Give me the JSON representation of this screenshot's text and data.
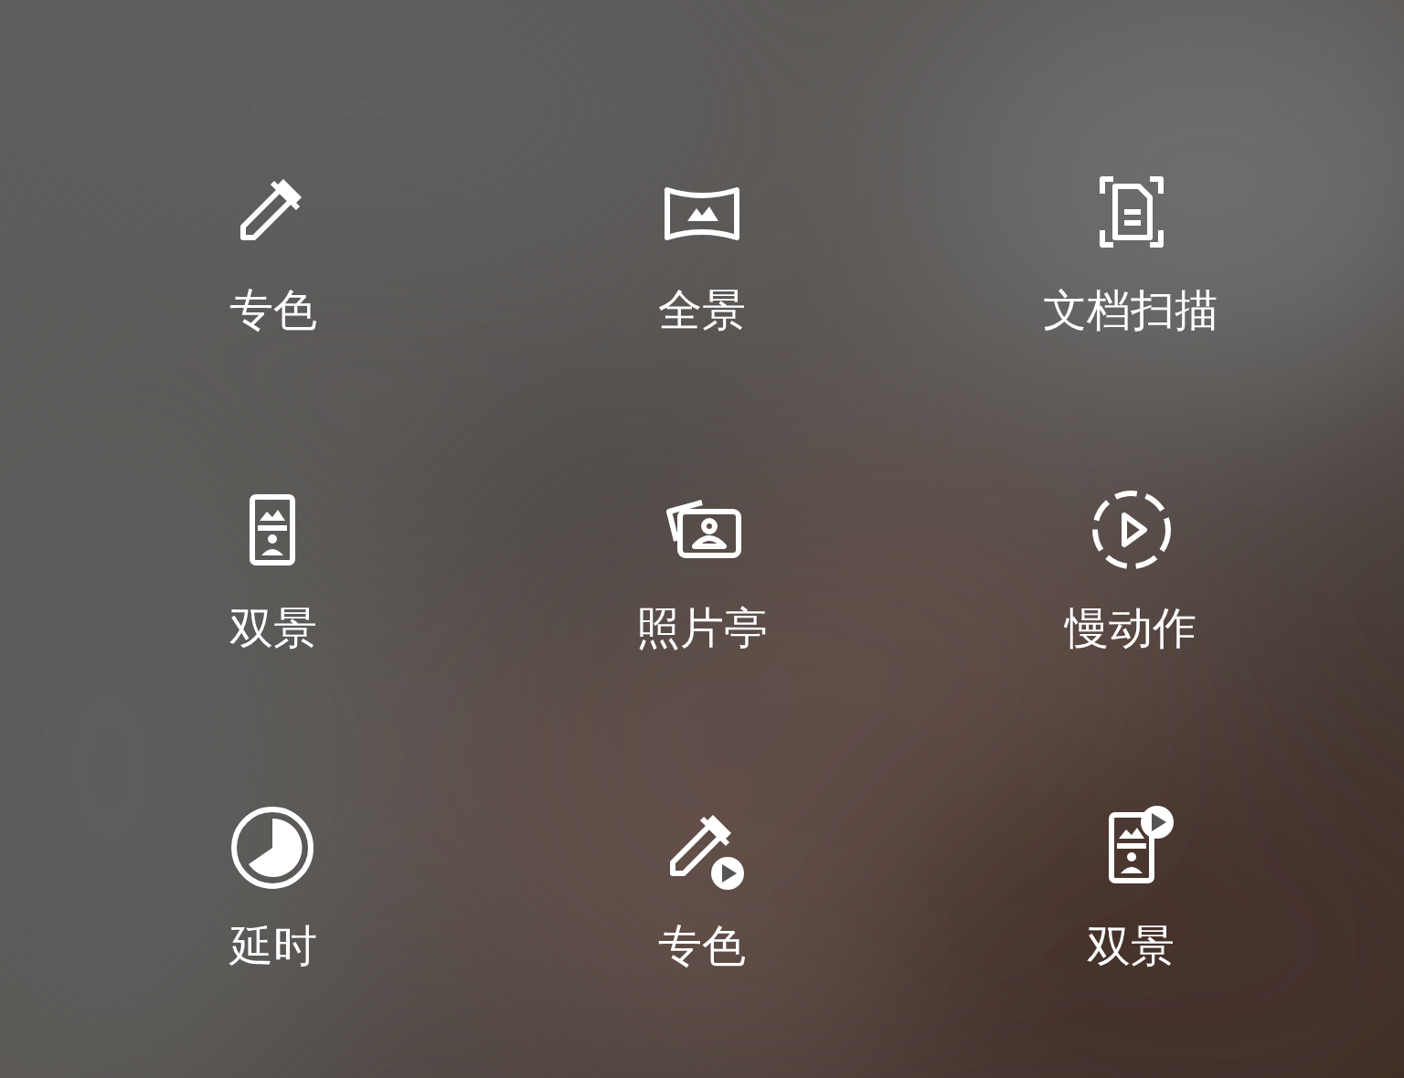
{
  "modes": [
    {
      "kind": "color-pick",
      "label": "专色"
    },
    {
      "kind": "panorama",
      "label": "全景"
    },
    {
      "kind": "doc-scan",
      "label": "文档扫描"
    },
    {
      "kind": "dual",
      "label": "双景"
    },
    {
      "kind": "photo-booth",
      "label": "照片亭"
    },
    {
      "kind": "slow-motion",
      "label": "慢动作"
    },
    {
      "kind": "timelapse",
      "label": "延时"
    },
    {
      "kind": "color-video",
      "label": "专色"
    },
    {
      "kind": "dual-video",
      "label": "双景"
    }
  ]
}
